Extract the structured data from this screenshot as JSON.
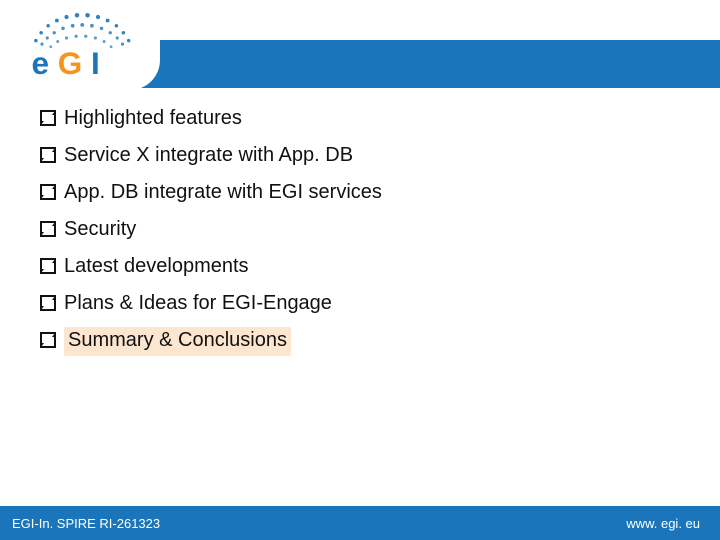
{
  "logo": {
    "text": "EGI",
    "alt": "egi-logo"
  },
  "bullets": [
    {
      "text": "Highlighted features",
      "highlight": false
    },
    {
      "text": "Service X integrate with App. DB",
      "highlight": false
    },
    {
      "text": "App. DB integrate with EGI services",
      "highlight": false
    },
    {
      "text": "Security",
      "highlight": false
    },
    {
      "text": "Latest developments",
      "highlight": false
    },
    {
      "text": "Plans & Ideas for EGI-Engage",
      "highlight": false
    },
    {
      "text": "Summary & Conclusions",
      "highlight": true
    }
  ],
  "footer": {
    "left": "EGI-In. SPIRE RI-261323",
    "right": "www. egi. eu"
  },
  "colors": {
    "brand_blue": "#1b75bb",
    "highlight_bg": "#fde6cf"
  }
}
